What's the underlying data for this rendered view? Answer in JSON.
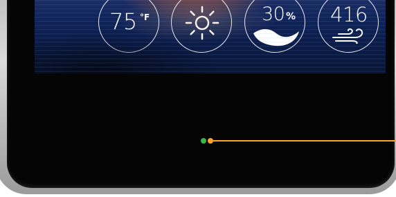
{
  "weather": {
    "temperature": {
      "value": "75",
      "unit": "°F"
    },
    "condition": {
      "icon": "sun-icon"
    },
    "humidity": {
      "value": "30",
      "unit": "%",
      "icon": "humidity-wave-icon"
    },
    "wind": {
      "value": "416",
      "icon": "wind-icon"
    }
  },
  "indicators": {
    "left_dot_color": "#37b84f",
    "right_dot_color": "#ffa42a",
    "line_color": "#ffa42a"
  }
}
